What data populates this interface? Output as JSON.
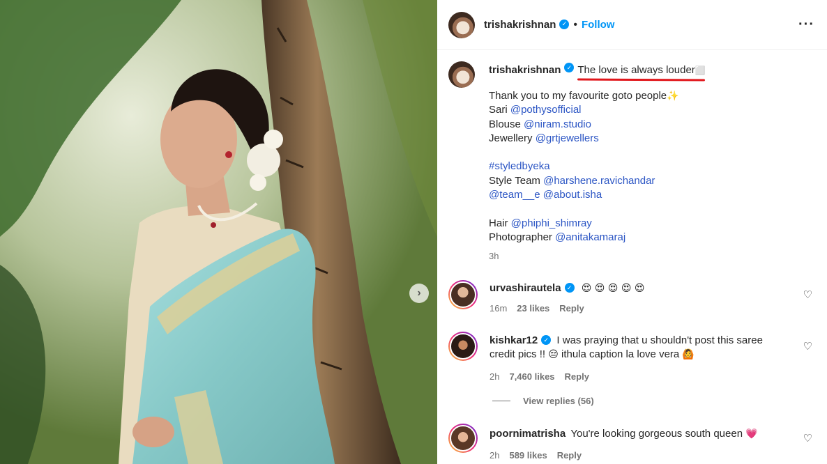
{
  "post": {
    "author": "trishakrishnan",
    "follow_label": "Follow",
    "more_icon": "more-horizontal-icon",
    "next_icon": "chevron-right-icon",
    "caption_headline": "The love is always louder",
    "caption_headline_trailing": "⬜",
    "caption_lines": [
      {
        "text": "Thank you to my favourite goto people",
        "suffix": "✨"
      },
      {
        "label": "Sari ",
        "mention": "@pothysofficial"
      },
      {
        "label": "Blouse ",
        "mention": "@niram.studio"
      },
      {
        "label": "Jewellery ",
        "mention": "@grtjewellers"
      },
      {
        "label": "Style Team ",
        "mention": "@harshene.ravichandar"
      },
      {
        "label": "",
        "mention": "@team__e",
        "mention2": "@about.isha"
      },
      {
        "label": "Hair ",
        "mention": "@phiphi_shimray"
      },
      {
        "label": "Photographer ",
        "mention": "@anitakamaraj"
      }
    ],
    "hashtag": "#styledbyeka",
    "time": "3h"
  },
  "comments": [
    {
      "user": "urvashirautela",
      "verified": true,
      "text": "",
      "emoji": "😍 😍 😍 😍 😍",
      "time": "16m",
      "likes": "23 likes",
      "reply": "Reply"
    },
    {
      "user": "kishkar12",
      "verified": true,
      "text": "I was praying that u shouldn't post this saree credit pics !! ",
      "emoji1": "😔",
      "text2": " ithula caption la love vera ",
      "emoji2": "🙆",
      "time": "2h",
      "likes": "7,460 likes",
      "reply": "Reply"
    },
    {
      "user": "poornimatrisha",
      "verified": false,
      "text": "You're looking gorgeous south queen ",
      "emoji": "💗",
      "time": "2h",
      "likes": "589 likes",
      "reply": "Reply"
    }
  ],
  "view_replies": "View replies (56)",
  "colors": {
    "link": "#2b55c4",
    "follow": "#0095f6",
    "underline": "#e1161b",
    "saree": "#8fd0cf"
  }
}
